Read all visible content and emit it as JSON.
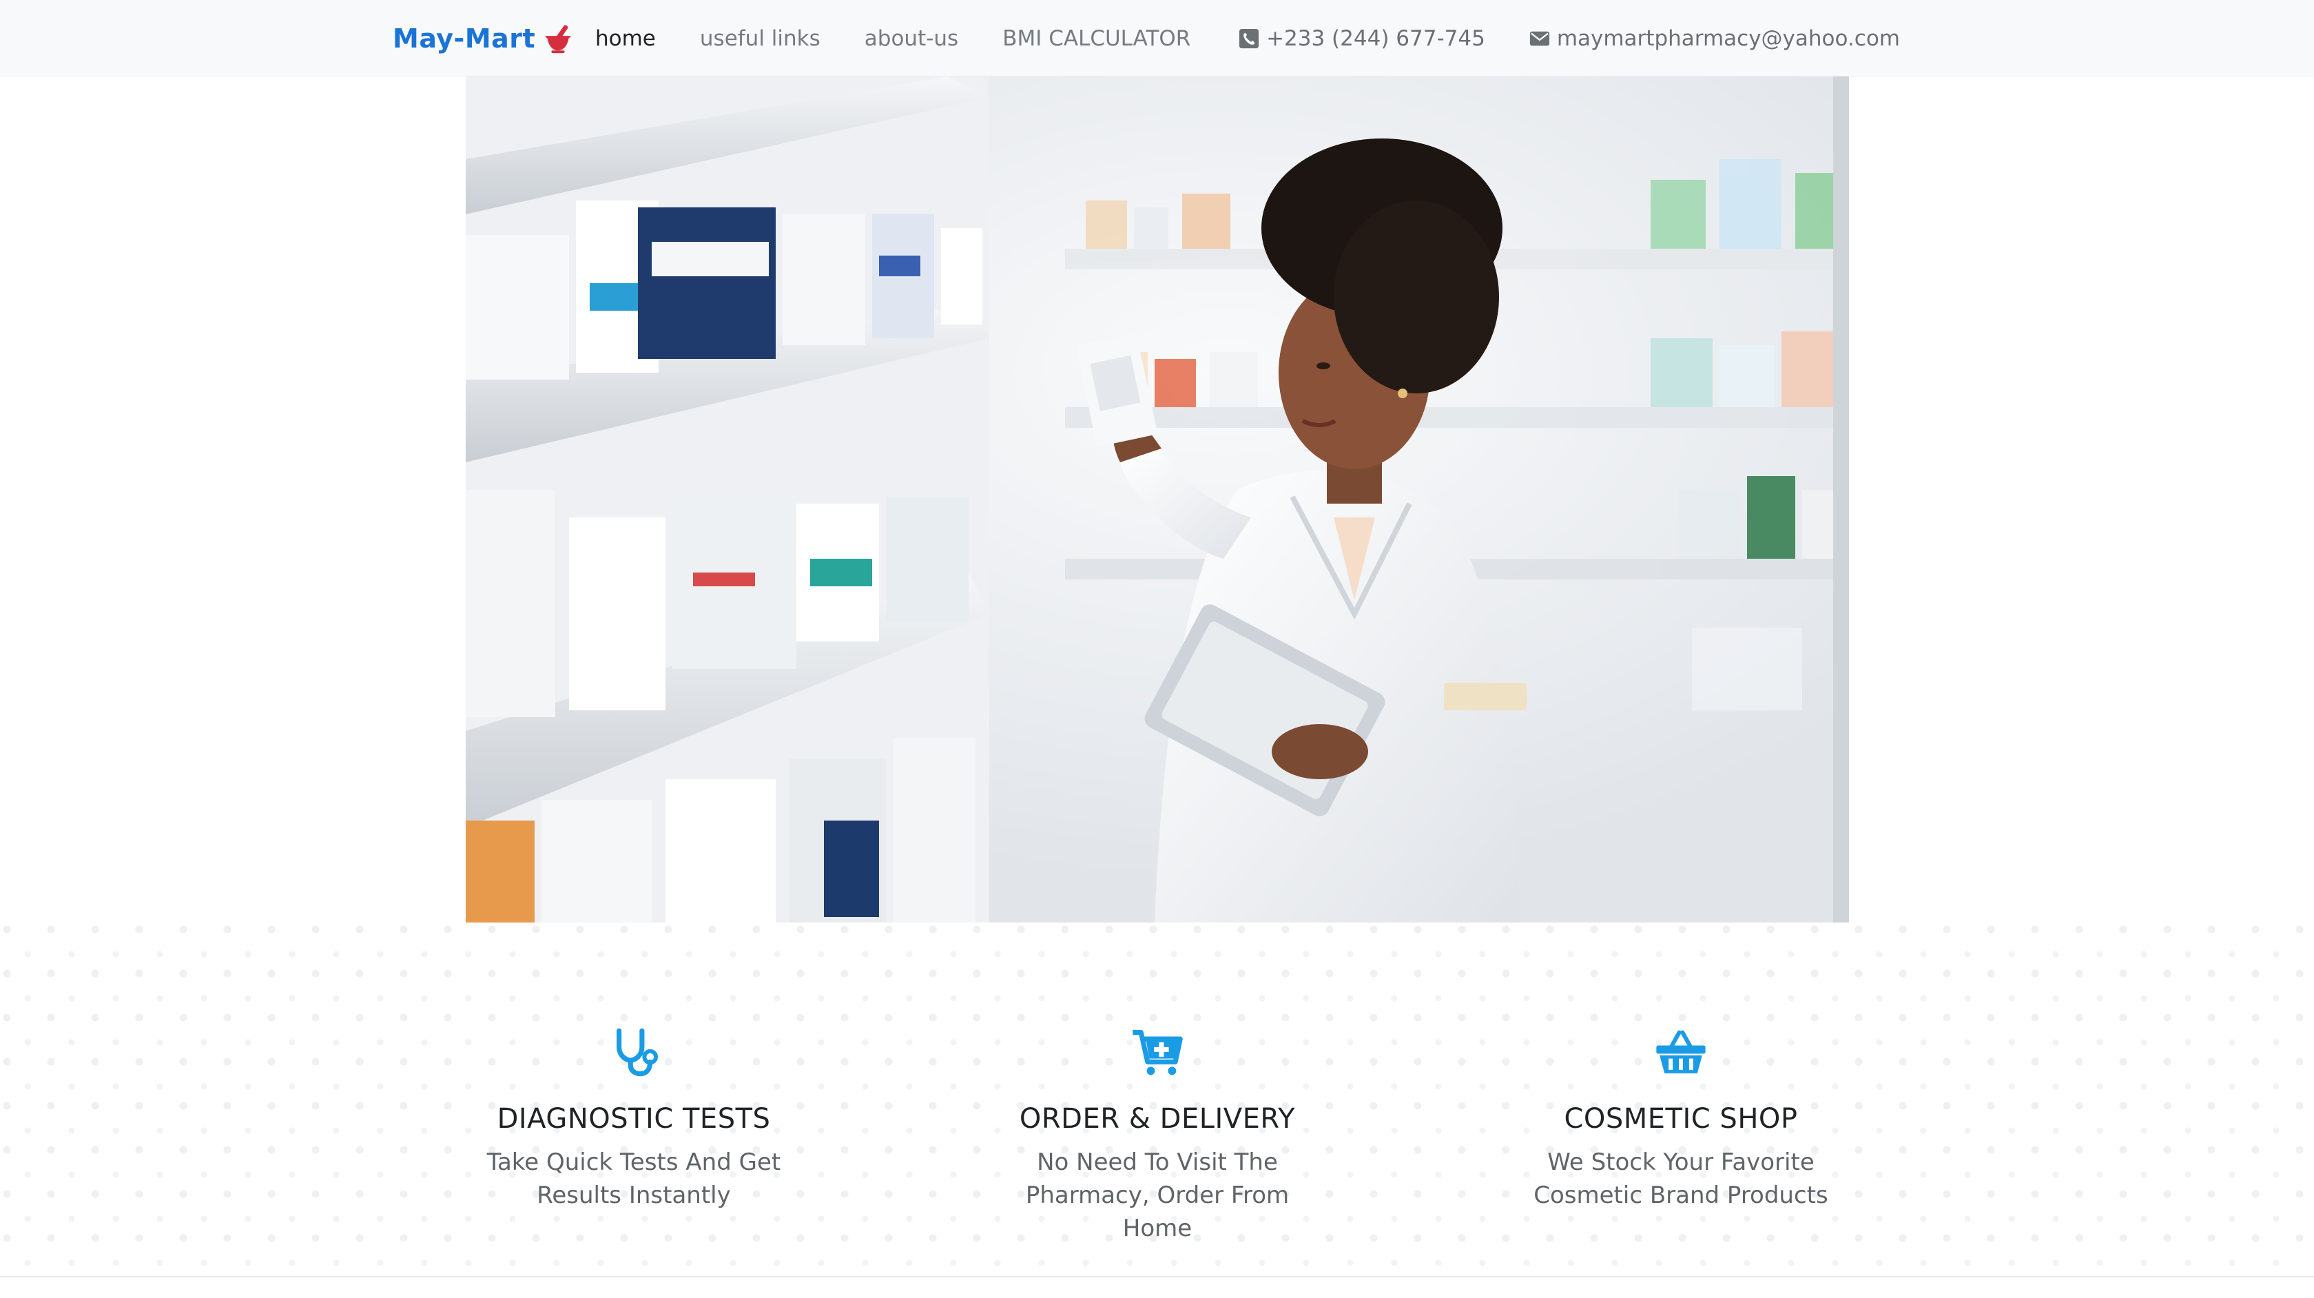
{
  "navbar": {
    "brand": "May-Mart",
    "links": [
      {
        "label": "home",
        "active": true
      },
      {
        "label": "useful links",
        "active": false
      },
      {
        "label": "about-us",
        "active": false
      },
      {
        "label": "BMI CALCULATOR",
        "active": false
      }
    ],
    "phone": "+233 (244) 677-745",
    "email": "maymartpharmacy@yahoo.com",
    "brand_color": "#1a73d6",
    "brand_icon_color": "#d62d3f"
  },
  "hero": {
    "icon": "pharmacist-photo"
  },
  "features": [
    {
      "icon": "stethoscope-icon",
      "title": "DIAGNOSTIC TESTS",
      "desc": "Take Quick Tests And Get Results Instantly"
    },
    {
      "icon": "cart-plus-icon",
      "title": "ORDER & DELIVERY",
      "desc": "No Need To Visit The Pharmacy, Order From Home"
    },
    {
      "icon": "basket-icon",
      "title": "COSMETIC SHOP",
      "desc": "We Stock Your Favorite Cosmetic Brand Products"
    }
  ],
  "accent_color": "#1a9be6"
}
